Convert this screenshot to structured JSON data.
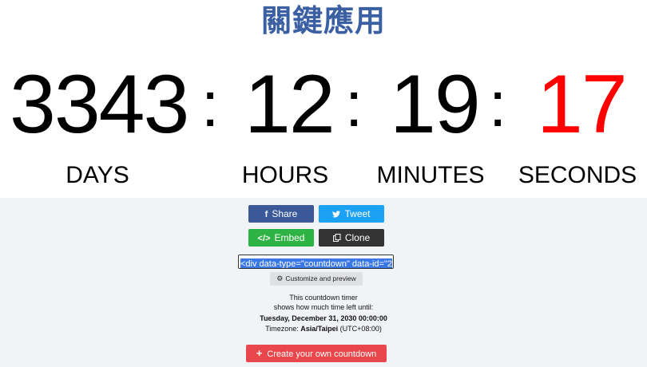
{
  "title": "關鍵應用",
  "countdown": {
    "days": "3343",
    "hours": "12",
    "minutes": "19",
    "seconds": "17",
    "separator": ":",
    "labels": {
      "days": "DAYS",
      "hours": "HOURS",
      "minutes": "MINUTES",
      "seconds": "SECONDS"
    },
    "seconds_color": "#ff0000"
  },
  "actions": {
    "share_label": "Share",
    "tweet_label": "Tweet",
    "embed_label": "Embed",
    "clone_label": "Clone",
    "embed_code": "<div data-type=\"countdown\" data-id=\"2",
    "customize_label": "Customize and preview",
    "create_label": "Create your own countdown"
  },
  "icons": {
    "share": "facebook-icon",
    "tweet": "twitter-icon",
    "embed": "code-icon",
    "clone": "copy-icon",
    "customize": "gears-icon",
    "create": "plus-icon"
  },
  "info": {
    "line1": "This countdown timer",
    "line2": "shows how much time left until:",
    "target_date": "Tuesday, December 31, 2030 00:00:00",
    "timezone_prefix": "Timezone:",
    "timezone_name": "Asia/Taipei",
    "timezone_offset": "(UTC+08:00)"
  },
  "colors": {
    "title": "#3b5fa3",
    "share": "#3b5998",
    "tweet": "#1da1f2",
    "embed": "#2fb344",
    "clone": "#333333",
    "create": "#e8474c",
    "panel_bg": "#f1f3f6"
  }
}
